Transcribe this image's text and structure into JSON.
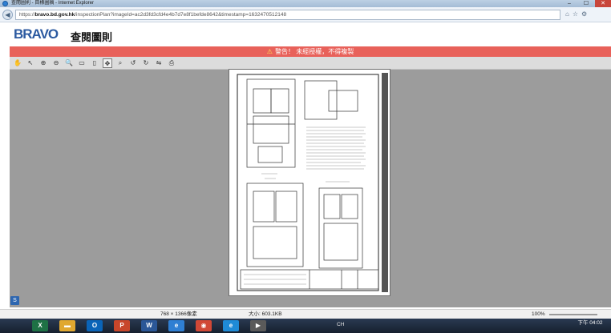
{
  "browser": {
    "title": "查閱圖則 - 目標圖稿 - Internet Explorer",
    "url_prefix": "https://",
    "url_domain": "bravo.bd.gov.hk",
    "url_rest": "/inspectionPlan?imageId=ac2d3fd3cfd4e4b7d7e8f1befde8642&timestamp=1632470512148",
    "min_label": "–",
    "max_label": "☐",
    "close_label": "✕"
  },
  "header": {
    "logo": "BRAVO",
    "title": "查閱圖則"
  },
  "warning": {
    "icon": "⚠",
    "text": "警告！ 未經授權，不得複製"
  },
  "toolbar": {
    "tools": [
      {
        "name": "pan-tool-icon",
        "glyph": "✋"
      },
      {
        "name": "select-tool-icon",
        "glyph": "↖"
      },
      {
        "name": "zoom-in-icon",
        "glyph": "⊕"
      },
      {
        "name": "zoom-out-icon",
        "glyph": "⊖"
      },
      {
        "name": "magnifier-icon",
        "glyph": "🔍"
      },
      {
        "name": "fit-width-icon",
        "glyph": "▭"
      },
      {
        "name": "fit-page-icon",
        "glyph": "▯"
      },
      {
        "name": "fit-window-icon",
        "glyph": "✥"
      },
      {
        "name": "actual-size-icon",
        "glyph": "⌕"
      },
      {
        "name": "rotate-left-icon",
        "glyph": "↺"
      },
      {
        "name": "rotate-right-icon",
        "glyph": "↻"
      },
      {
        "name": "flip-icon",
        "glyph": "⇋"
      },
      {
        "name": "print-icon",
        "glyph": "⎙"
      }
    ]
  },
  "status": {
    "dimensions": "768 × 1366像素",
    "size": "大小: 603.1KB",
    "zoom": "100%"
  },
  "taskbar": {
    "tray_text": "CH",
    "clock_time": "下午 04:02",
    "apps": [
      {
        "name": "excel-app-icon",
        "label": "X",
        "color": "#1e7145"
      },
      {
        "name": "folder-app-icon",
        "label": "▬",
        "color": "#e0a830"
      },
      {
        "name": "outlook-app-icon",
        "label": "O",
        "color": "#0a64b8"
      },
      {
        "name": "powerpoint-app-icon",
        "label": "P",
        "color": "#c8462a"
      },
      {
        "name": "word-app-icon",
        "label": "W",
        "color": "#2b5797"
      },
      {
        "name": "ie-app-icon",
        "label": "e",
        "color": "#2f7fd3"
      },
      {
        "name": "chrome-app-icon",
        "label": "◉",
        "color": "#d14836"
      },
      {
        "name": "edge-app-icon",
        "label": "e",
        "color": "#1f8bd6"
      },
      {
        "name": "media-app-icon",
        "label": "▶",
        "color": "#5a5a5a"
      }
    ]
  }
}
